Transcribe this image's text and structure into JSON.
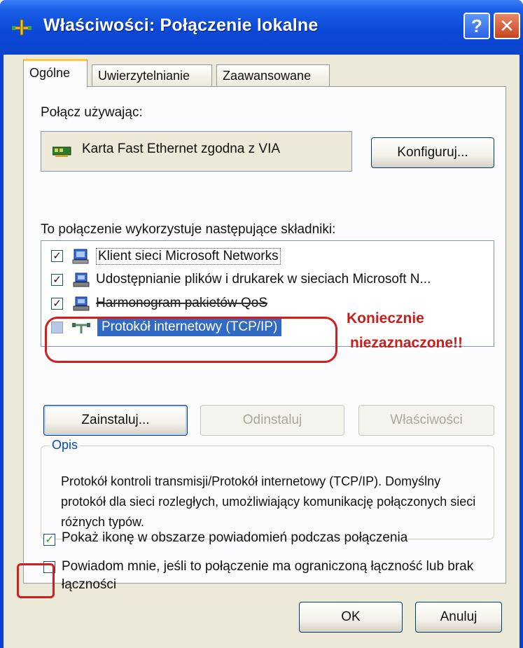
{
  "window": {
    "title": "Właściwości: Połączenie lokalne",
    "help_label": "?",
    "close_label": "✕"
  },
  "tabs": [
    {
      "label": "Ogólne",
      "active": true
    },
    {
      "label": "Uwierzytelnianie",
      "active": false
    },
    {
      "label": "Zaawansowane",
      "active": false
    }
  ],
  "connect_using": {
    "label": "Połącz używając:",
    "adapter": "Karta Fast Ethernet zgodna z VIA",
    "configure_label": "Konfiguruj..."
  },
  "components": {
    "label": "To połączenie wykorzystuje następujące składniki:",
    "items": [
      {
        "label": "Klient sieci Microsoft Networks",
        "checked": true
      },
      {
        "label": "Udostępnianie plików i drukarek w sieciach Microsoft N...",
        "checked": true
      },
      {
        "label": "Harmonogram pakietów QoS",
        "checked": true
      },
      {
        "label": "Protokół internetowy (TCP/IP)",
        "checked": false,
        "selected": true
      }
    ]
  },
  "annotation": {
    "line1": "Koniecznie",
    "line2": "niezaznaczone!!",
    "color": "#c81e1e"
  },
  "buttons": {
    "install": "Zainstaluj...",
    "uninstall": "Odinstaluj",
    "properties": "Właściwości",
    "ok": "OK",
    "cancel": "Anuluj"
  },
  "description": {
    "legend": "Opis",
    "text": "Protokół kontroli transmisji/Protokół internetowy (TCP/IP). Domyślny protokół dla sieci rozległych, umożliwiający komunikację połączonych sieci różnych typów."
  },
  "options": [
    {
      "label": "Pokaż ikonę w obszarze powiadomień podczas połączenia",
      "checked": true
    },
    {
      "label": "Powiadom mnie, jeśli to połączenie ma ograniczoną łączność lub brak łączności",
      "checked": false
    }
  ],
  "colors": {
    "titlebar": "#0a45cc",
    "dialog_bg": "#ece9d8",
    "selection": "#316ac5",
    "highlight_red": "#d11e1e"
  }
}
